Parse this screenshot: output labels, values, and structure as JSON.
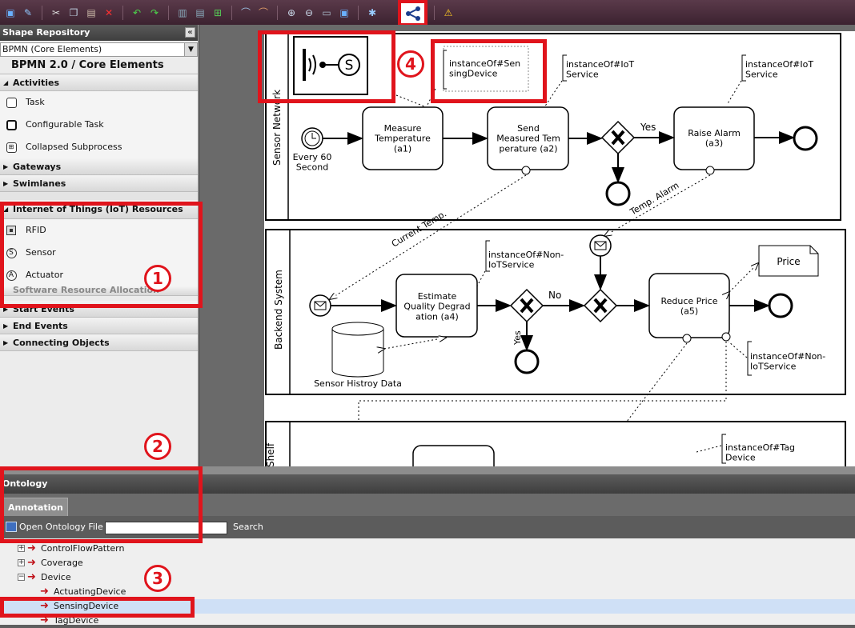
{
  "toolbar": {
    "icons": [
      "save-icon",
      "edit-icon",
      "cut-icon",
      "copy-icon",
      "paste-icon",
      "delete-icon",
      "undo-icon",
      "redo-icon",
      "align-icon",
      "distribute-icon",
      "arrange-icon",
      "add-point-icon",
      "remove-point-icon",
      "zoom-in-icon",
      "zoom-out-icon",
      "zoom-fit-icon",
      "fullscreen-icon",
      "settings-icon",
      "share-icon",
      "warning-icon"
    ]
  },
  "shape_repository": {
    "header": "Shape Repository",
    "stencil_select": "BPMN (Core Elements)",
    "title": "BPMN 2.0 / Core Elements",
    "groups": {
      "activities": "Activities",
      "gateways": "Gateways",
      "swimlanes": "Swimlanes",
      "iot": "Internet of Things (IoT) Resources",
      "software_alloc": "Software Resource Allocation",
      "start_events": "Start Events",
      "end_events": "End Events",
      "connecting": "Connecting Objects"
    },
    "activity_items": [
      "Task",
      "Configurable Task",
      "Collapsed Subprocess"
    ],
    "iot_items": [
      "RFID",
      "Sensor",
      "Actuator"
    ]
  },
  "diagram": {
    "lanes": [
      "Sensor Network",
      "Backend System",
      "Shelf"
    ],
    "tasks": {
      "a1": "Measure\nTemperature\n(a1)",
      "a2": "Send\nMeasured Tem\nperature (a2)",
      "a3": "Raise Alarm\n(a3)",
      "a4": "Estimate\nQuality Degrad\nation (a4)",
      "a5": "Reduce Price\n(a5)"
    },
    "timer_label": "Every 60\nSecond",
    "yes_top": "Yes",
    "no_label": "No",
    "yes_bottom": "Yes",
    "current_temp": "Current Temp.",
    "temp_alarm": "Temp. Alarm",
    "annotations": {
      "sensing_device": "instanceOf#Sen\nsingDevice",
      "iot_service_1": "instanceOf#IoT\nService",
      "iot_service_2": "instanceOf#IoT\nService",
      "non_iot_1": "instanceOf#Non-\nIoTService",
      "non_iot_2": "instanceOf#Non-\nIoTService",
      "tag_device": "instanceOf#Tag\nDevice"
    },
    "price_doc": "Price",
    "data_store": "Sensor Histroy Data",
    "sensor_symbol": "S"
  },
  "callouts": [
    "1",
    "2",
    "3",
    "4"
  ],
  "ontology": {
    "header": "Ontology",
    "tab": "Annotation",
    "open_file": "Open Ontology File",
    "search_value": "",
    "search_label": "Search",
    "tree": [
      {
        "label": "ControlFlowPattern",
        "expander": "+"
      },
      {
        "label": "Coverage",
        "expander": "+"
      },
      {
        "label": "Device",
        "expander": "−"
      },
      {
        "label": "ActuatingDevice",
        "expander": ""
      },
      {
        "label": "SensingDevice",
        "expander": ""
      },
      {
        "label": "TagDevice",
        "expander": ""
      }
    ]
  }
}
